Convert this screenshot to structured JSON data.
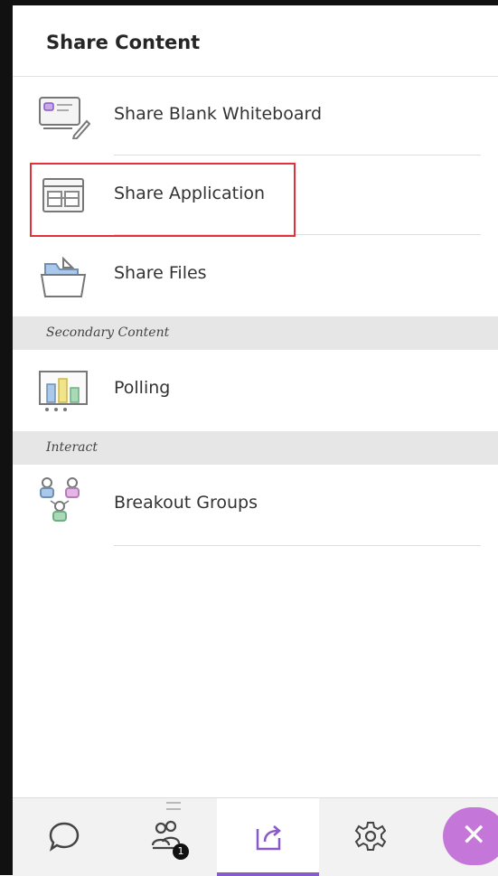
{
  "header": {
    "title": "Share Content"
  },
  "items": [
    {
      "label": "Share Blank Whiteboard",
      "icon": "whiteboard-icon"
    },
    {
      "label": "Share Application",
      "icon": "application-window-icon"
    },
    {
      "label": "Share Files",
      "icon": "files-folder-icon"
    }
  ],
  "sections": {
    "secondary": {
      "label": "Secondary Content"
    },
    "interact": {
      "label": "Interact"
    }
  },
  "secondary_items": [
    {
      "label": "Polling",
      "icon": "polling-chart-icon"
    }
  ],
  "interact_items": [
    {
      "label": "Breakout Groups",
      "icon": "breakout-groups-icon"
    }
  ],
  "tabbar": {
    "tabs": [
      {
        "icon": "chat-icon"
      },
      {
        "icon": "attendees-icon",
        "badge": "1"
      },
      {
        "icon": "share-content-icon",
        "active": true
      },
      {
        "icon": "settings-gear-icon"
      }
    ],
    "close_icon": "close-icon"
  },
  "colors": {
    "accent": "#8a59c9",
    "close_fab": "#c477d9",
    "highlight": "#e2313b",
    "section_bg": "#e6e6e6"
  }
}
